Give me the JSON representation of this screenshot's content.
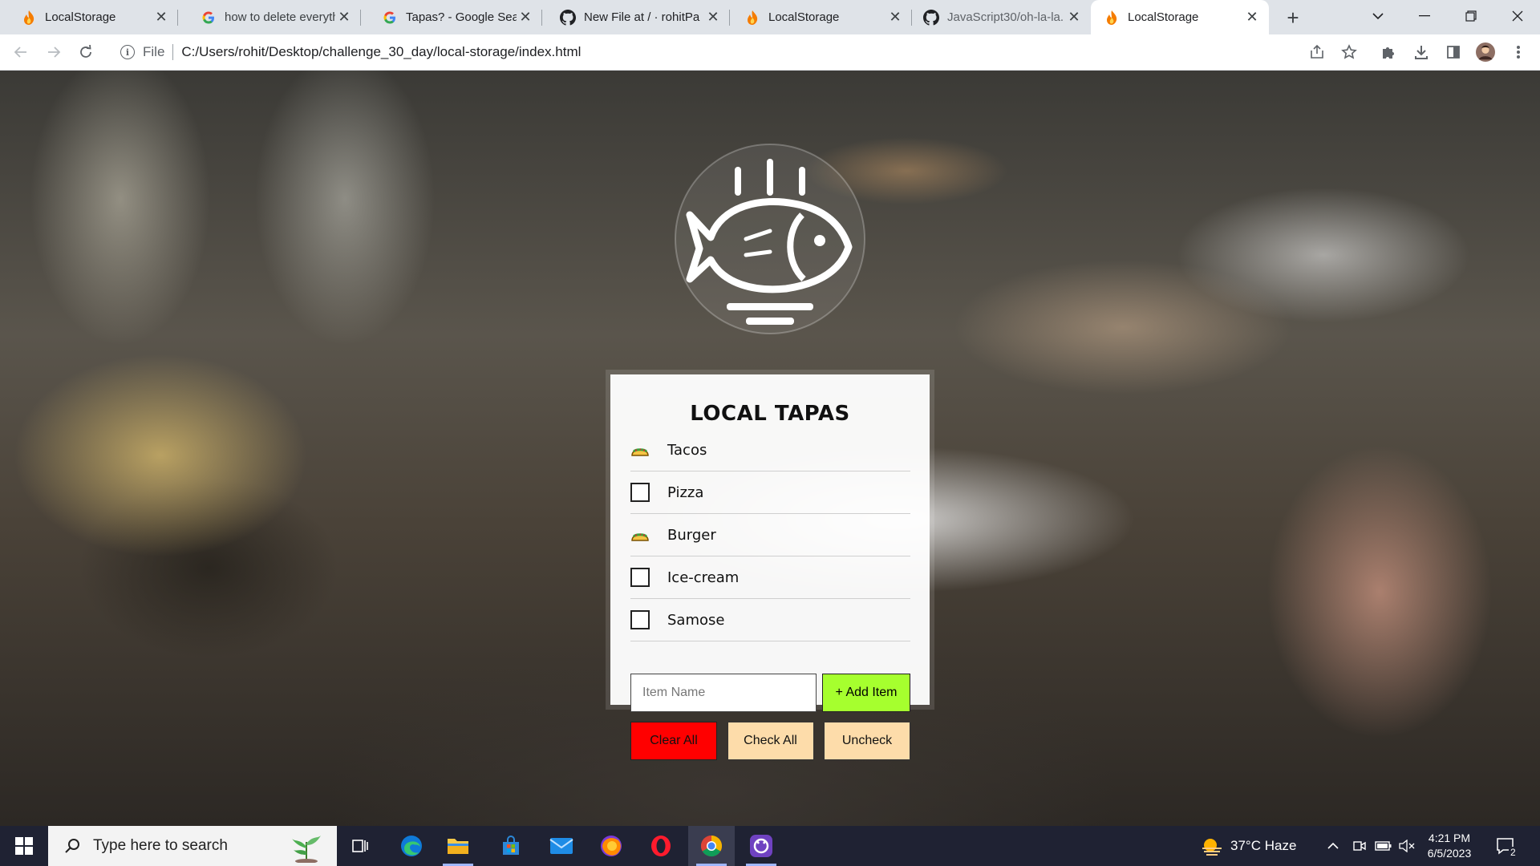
{
  "browser": {
    "tabs": [
      {
        "title": "LocalStorage",
        "favicon": "flame-icon"
      },
      {
        "title": "how to delete everyth",
        "favicon": "google-icon"
      },
      {
        "title": "Tapas? - Google Searc",
        "favicon": "google-icon"
      },
      {
        "title": "New File at / · rohitPa",
        "favicon": "github-icon"
      },
      {
        "title": "LocalStorage",
        "favicon": "flame-icon"
      },
      {
        "title": "JavaScript30/oh-la-la.",
        "favicon": "github-icon"
      },
      {
        "title": "LocalStorage",
        "favicon": "flame-icon",
        "active": true
      }
    ],
    "address": {
      "scheme": "File",
      "url": "C:/Users/rohit/Desktop/challenge_30_day/local-storage/index.html"
    }
  },
  "app": {
    "title": "LOCAL TAPAS",
    "items": [
      {
        "label": "Tacos",
        "checked": true
      },
      {
        "label": "Pizza",
        "checked": false
      },
      {
        "label": "Burger",
        "checked": true
      },
      {
        "label": "Ice-cream",
        "checked": false
      },
      {
        "label": "Samose",
        "checked": false
      }
    ],
    "input_placeholder": "Item Name",
    "add_label": "+ Add Item",
    "clear_label": "Clear All",
    "check_label": "Check All",
    "uncheck_label": "Uncheck"
  },
  "taskbar": {
    "search_placeholder": "Type here to search",
    "weather": "37°C  Haze",
    "time": "4:21 PM",
    "date": "6/5/2023",
    "notifications": "2"
  },
  "colors": {
    "add_button": "#a6ff2e",
    "clear_button": "#ff0000",
    "secondary_button": "#fddcaa"
  }
}
